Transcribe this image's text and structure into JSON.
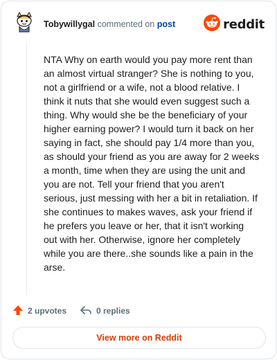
{
  "header": {
    "username": "Tobywillygal",
    "verb": "commented on",
    "post_link": "post",
    "logo_text": "reddit",
    "avatar_icon": "snoo-avatar-icon",
    "logo_icon": "reddit-snoo-icon"
  },
  "comment": {
    "text": "NTA Why on earth would you pay more rent than an almost virtual stranger? She is nothing to you, not a girlfriend or a wife, not a blood relative. I think it nuts that she would even suggest such a thing. Why would she be the beneficiary of your higher earning power? I would turn it back on her saying in fact, she should pay 1/4 more than you, as should your friend as you are away for 2 weeks a month, time when they are using the unit and you are not. Tell your friend that you aren't serious, just messing with her a bit in retaliation. If she continues to makes waves, ask your friend if he prefers you leave or her, that it isn't working out with her. Otherwise, ignore her completely while you are there..she sounds like a pain in the arse."
  },
  "actions": {
    "upvotes": "2 upvotes",
    "replies": "0 replies",
    "upvote_icon": "upvote-arrow-icon",
    "reply_icon": "reply-arrow-icon"
  },
  "footer": {
    "view_more": "View more on Reddit"
  },
  "colors": {
    "brand": "#ff4500",
    "link": "#0045ac",
    "button_text": "#d93a00",
    "muted": "#576f76"
  }
}
